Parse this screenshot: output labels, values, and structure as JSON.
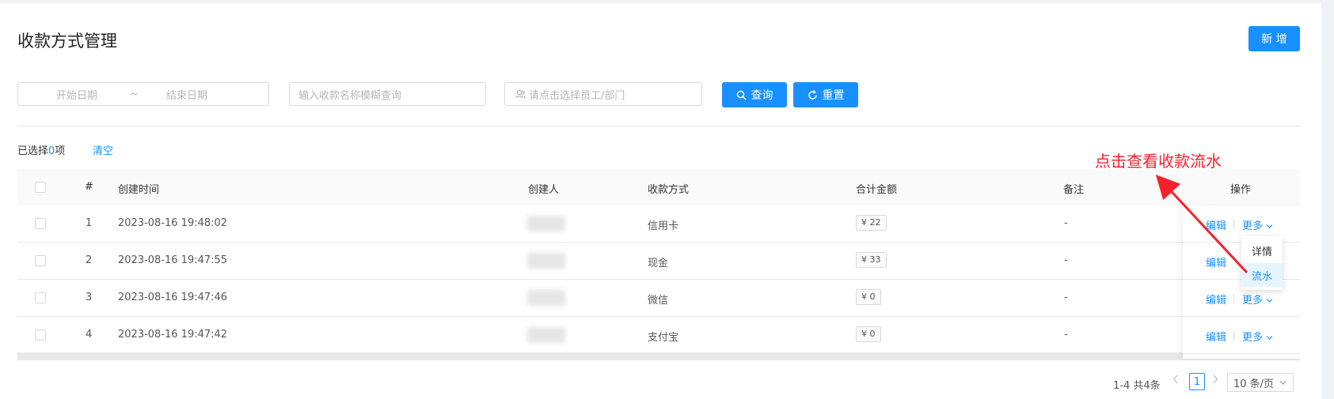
{
  "page": {
    "title": "收款方式管理",
    "add_label": "新 增"
  },
  "filters": {
    "start_placeholder": "开始日期",
    "range_sep": "~",
    "end_placeholder": "结束日期",
    "name_placeholder": "输入收款名称模糊查询",
    "staff_placeholder": "请点击选择员工/部门",
    "query_label": "查询",
    "reset_label": "重置"
  },
  "selection": {
    "prefix": "已选择",
    "count": "0",
    "suffix": "项",
    "clear_label": "清空"
  },
  "annotation": {
    "text": "点击查看收款流水",
    "color": "#f5222d"
  },
  "table": {
    "columns": [
      "#",
      "创建时间",
      "创建人",
      "收款方式",
      "合计金额",
      "备注",
      "操作"
    ],
    "rows": [
      {
        "index": "1",
        "created_at": "2023-08-16 19:48:02",
        "method": "信用卡",
        "amount": "¥ 22",
        "remark": "-"
      },
      {
        "index": "2",
        "created_at": "2023-08-16 19:47:55",
        "method": "现金",
        "amount": "¥ 33",
        "remark": "-"
      },
      {
        "index": "3",
        "created_at": "2023-08-16 19:47:46",
        "method": "微信",
        "amount": "¥ 0",
        "remark": "-"
      },
      {
        "index": "4",
        "created_at": "2023-08-16 19:47:42",
        "method": "支付宝",
        "amount": "¥ 0",
        "remark": "-"
      }
    ],
    "edit_label": "编辑",
    "more_label": "更多"
  },
  "dropdown": {
    "items": [
      "详情",
      "流水"
    ],
    "active": "流水"
  },
  "pagination": {
    "total_text": "1-4 共4条",
    "current_page": "1",
    "page_size": "10 条/页"
  },
  "colors": {
    "primary": "#1890ff",
    "annotation": "#f5222d"
  },
  "icons": {
    "query": "search-icon",
    "reset": "refresh-icon",
    "staff": "user-group-icon",
    "more": "chevron-down-icon",
    "prev": "chevron-left-icon",
    "next": "chevron-right-icon"
  }
}
